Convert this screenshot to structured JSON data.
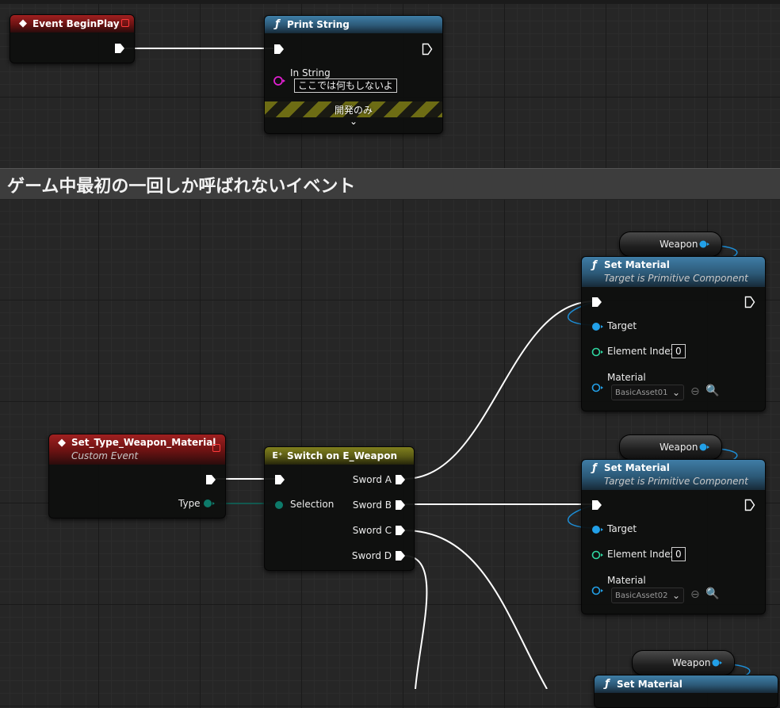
{
  "colors": {
    "exec": "#ffffff",
    "object_pin": "#22a0e8",
    "int_pin": "#2fd6a0",
    "string_pin": "#e020d0",
    "enum_pin": "#0d7a6a",
    "event_header": "#8a1a1a",
    "function_header": "#2f6a8f",
    "switch_header": "#6e6e18"
  },
  "comment": {
    "title": "ゲーム中最初の一回しか呼ばれないイベント"
  },
  "event_begin_play": {
    "title": "Event BeginPlay",
    "icon": "event-diamond-icon"
  },
  "print_string": {
    "title": "Print String",
    "in_string_label": "In String",
    "in_string_value": "ここでは何もしないよ",
    "dev_only_label": "開発のみ",
    "icon": "function-icon"
  },
  "custom_event": {
    "title": "Set_Type_Weapon_Material",
    "subtitle": "Custom Event",
    "type_label": "Type"
  },
  "switch_node": {
    "title": "Switch on E_Weapon",
    "selection_label": "Selection",
    "outputs": [
      "Sword A",
      "Sword B",
      "Sword C",
      "Sword D"
    ]
  },
  "weapon_var_label": "Weapon",
  "set_material_nodes": [
    {
      "title": "Set Material",
      "subtitle": "Target is Primitive Component",
      "target_label": "Target",
      "element_index_label": "Element Index",
      "element_index_value": "0",
      "material_label": "Material",
      "material_value": "BasicAsset01"
    },
    {
      "title": "Set Material",
      "subtitle": "Target is Primitive Component",
      "target_label": "Target",
      "element_index_label": "Element Index",
      "element_index_value": "0",
      "material_label": "Material",
      "material_value": "BasicAsset02"
    },
    {
      "title": "Set Material"
    }
  ]
}
